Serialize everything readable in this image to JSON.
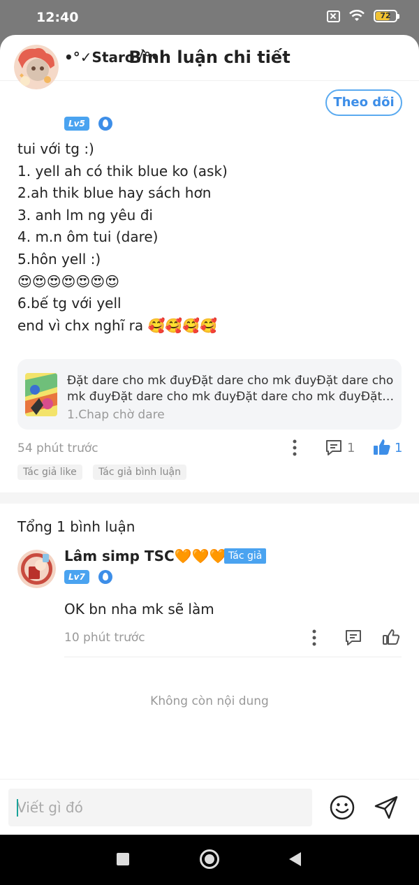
{
  "status_bar": {
    "time": "12:40",
    "battery_level": "72"
  },
  "header": {
    "title": "Bình luận chi tiết"
  },
  "post": {
    "author": {
      "name": "•°✓Staro√°•",
      "level": "Lv5"
    },
    "follow_label": "Theo dõi",
    "body_lines": [
      "tui với tg :)",
      "1. yell ah có thik blue ko (ask)",
      "2.ah thik blue hay sách hơn",
      "3. anh lm ng yêu đi",
      "4. m.n ôm tui (dare)",
      "5.hôn yell :)",
      "😍😍😍😍😍😍😍",
      "6.bế tg với yell",
      "end vì chx nghĩ ra 🥰🥰🥰🥰"
    ],
    "chapter_card": {
      "line1": "Đặt dare cho mk đuyĐặt dare cho mk đuyĐặt dare cho",
      "line2": "mk đuyĐặt dare cho mk đuyĐặt dare cho mk đuyĐặt dar...",
      "subtitle": "1.Chap chờ dare"
    },
    "time": "54 phút trước",
    "comment_count": "1",
    "like_count": "1",
    "tags": [
      "Tác giả like",
      "Tác giả bình luận"
    ]
  },
  "comments_section": {
    "total": "Tổng 1 bình luận",
    "comments": [
      {
        "name": "Lâm simp TSC🧡🧡🧡",
        "author_badge": "Tác giả",
        "level": "Lv7",
        "text": "OK bn nha mk sẽ làm",
        "time": "10 phút trước"
      }
    ],
    "end_text": "Không còn nội dung"
  },
  "input": {
    "placeholder": "Viết gì đó"
  },
  "colors": {
    "accent": "#3d8ee8",
    "badge": "#4aa3f0",
    "like_active": "#3d8ee8"
  }
}
